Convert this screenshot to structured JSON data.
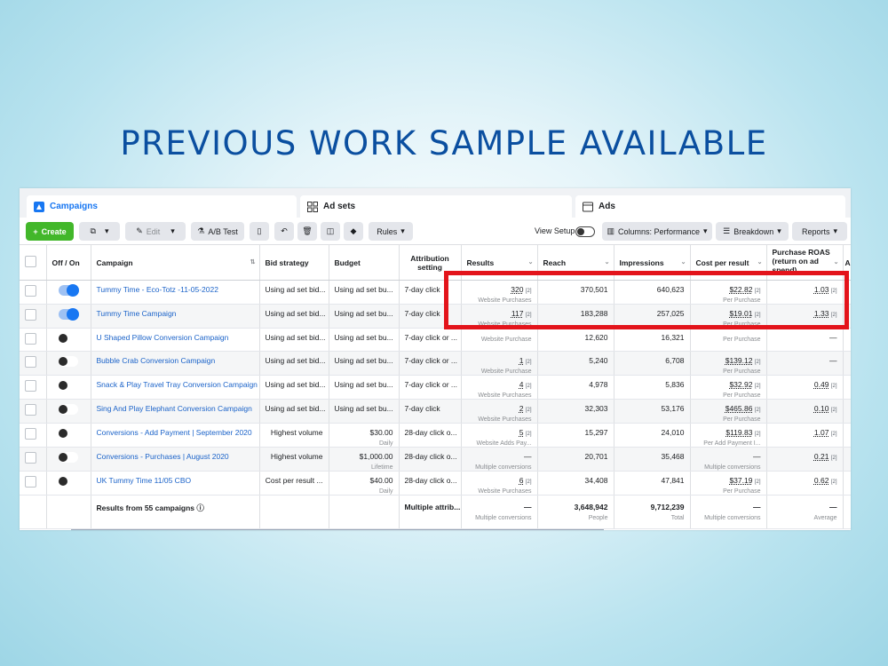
{
  "headline": "PREVIOUS WORK SAMPLE AVAILABLE",
  "tabs": [
    {
      "label": "Campaigns",
      "icon": "campaign-flag-icon"
    },
    {
      "label": "Ad sets",
      "icon": "grid-icon"
    },
    {
      "label": "Ads",
      "icon": "ad-window-icon"
    }
  ],
  "toolbar": {
    "create": "Create",
    "edit": "Edit",
    "ab_test": "A/B Test",
    "rules": "Rules",
    "view_setup": "View Setup",
    "columns": "Columns: Performance",
    "breakdown": "Breakdown",
    "reports": "Reports"
  },
  "columns": [
    "Off / On",
    "Campaign",
    "Bid strategy",
    "Budget",
    "Attribution setting",
    "Results",
    "Reach",
    "Impressions",
    "Cost per result",
    "Purchase ROAS (return on ad spend)",
    "A"
  ],
  "rows": [
    {
      "on": true,
      "campaign": "Tummy Time - Eco-Totz -11-05-2022",
      "bid": "Using ad set bid...",
      "budget": "Using ad set bu...",
      "budget_sub": "",
      "attr": "7-day click",
      "results": "320",
      "results_sub": "Website Purchases",
      "reach": "370,501",
      "impressions": "640,623",
      "cpr": "$22.82",
      "cpr_sub": "Per Purchase",
      "roas": "1.03"
    },
    {
      "on": true,
      "campaign": "Tummy Time Campaign",
      "bid": "Using ad set bid...",
      "budget": "Using ad set bu...",
      "budget_sub": "",
      "attr": "7-day click",
      "results": "117",
      "results_sub": "Website Purchases",
      "reach": "183,288",
      "impressions": "257,025",
      "cpr": "$19.01",
      "cpr_sub": "Per Purchase",
      "roas": "1.33"
    },
    {
      "on": false,
      "campaign": "U Shaped Pillow Conversion Campaign",
      "bid": "Using ad set bid...",
      "budget": "Using ad set bu...",
      "budget_sub": "",
      "attr": "7-day click or ...",
      "results": "",
      "results_sub": "Website Purchase",
      "reach": "12,620",
      "impressions": "16,321",
      "cpr": "",
      "cpr_sub": "Per Purchase",
      "roas": "—"
    },
    {
      "on": false,
      "campaign": "Bubble Crab Conversion Campaign",
      "bid": "Using ad set bid...",
      "budget": "Using ad set bu...",
      "budget_sub": "",
      "attr": "7-day click or ...",
      "results": "1",
      "results_sub": "Website Purchase",
      "reach": "5,240",
      "impressions": "6,708",
      "cpr": "$139.12",
      "cpr_sub": "Per Purchase",
      "roas": "—"
    },
    {
      "on": false,
      "campaign": "Snack & Play Travel Tray Conversion Campaign",
      "bid": "Using ad set bid...",
      "budget": "Using ad set bu...",
      "budget_sub": "",
      "attr": "7-day click or ...",
      "results": "4",
      "results_sub": "Website Purchases",
      "reach": "4,978",
      "impressions": "5,836",
      "cpr": "$32.92",
      "cpr_sub": "Per Purchase",
      "roas": "0.49"
    },
    {
      "on": false,
      "campaign": "Sing And Play Elephant Conversion Campaign",
      "bid": "Using ad set bid...",
      "budget": "Using ad set bu...",
      "budget_sub": "",
      "attr": "7-day click",
      "results": "2",
      "results_sub": "Website Purchases",
      "reach": "32,303",
      "impressions": "53,176",
      "cpr": "$465.86",
      "cpr_sub": "Per Purchase",
      "roas": "0.10"
    },
    {
      "on": false,
      "campaign": "Conversions - Add Payment | September 2020",
      "bid": "Highest volume",
      "budget": "$30.00",
      "budget_sub": "Daily",
      "attr": "28-day click o...",
      "results": "5",
      "results_sub": "Website Adds Pay...",
      "reach": "15,297",
      "impressions": "24,010",
      "cpr": "$119.83",
      "cpr_sub": "Per Add Payment I...",
      "roas": "1.07"
    },
    {
      "on": false,
      "campaign": "Conversions - Purchases | August 2020",
      "bid": "Highest volume",
      "budget": "$1,000.00",
      "budget_sub": "Lifetime",
      "attr": "28-day click o...",
      "results": "—",
      "results_sub": "Multiple conversions",
      "reach": "20,701",
      "impressions": "35,468",
      "cpr": "—",
      "cpr_sub": "Multiple conversions",
      "roas": "0.21"
    },
    {
      "on": false,
      "campaign": "UK Tummy Time 11/05 CBO",
      "bid": "Cost per result ...",
      "budget": "$40.00",
      "budget_sub": "Daily",
      "attr": "28-day click o...",
      "results": "6",
      "results_sub": "Website Purchases",
      "reach": "34,408",
      "impressions": "47,841",
      "cpr": "$37.19",
      "cpr_sub": "Per Purchase",
      "roas": "0.62"
    }
  ],
  "totals": {
    "label": "Results from 55 campaigns",
    "attr": "Multiple attrib...",
    "results": "—",
    "results_sub": "Multiple conversions",
    "reach": "3,648,942",
    "reach_sub": "People",
    "impressions": "9,712,239",
    "impressions_sub": "Total",
    "cpr": "—",
    "cpr_sub": "Multiple conversions",
    "roas": "—",
    "roas_sub": "Average"
  },
  "colors": {
    "highlight": "#e3141b",
    "headline": "#0b4fa0",
    "link": "#1b63c9",
    "create": "#42b72a"
  }
}
